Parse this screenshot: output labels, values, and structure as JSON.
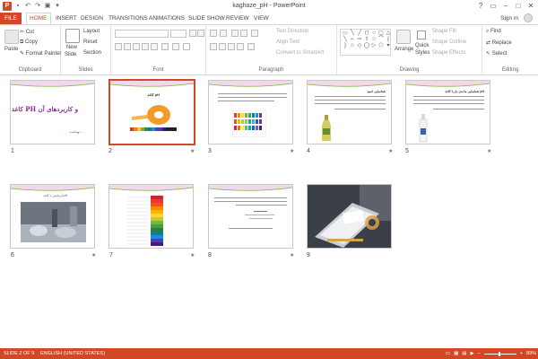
{
  "titlebar": {
    "title": "kaghaze_pH - PowerPoint",
    "app_icon": "P",
    "qat": [
      "save-icon",
      "undo-icon",
      "redo-icon",
      "presentation-icon",
      "customize-icon"
    ],
    "window_buttons": [
      "?",
      "▭",
      "–",
      "□",
      "✕"
    ]
  },
  "tabs": {
    "file": "FILE",
    "items": [
      "HOME",
      "INSERT",
      "DESIGN",
      "TRANSITIONS",
      "ANIMATIONS",
      "SLIDE SHOW",
      "REVIEW",
      "VIEW"
    ],
    "active": "HOME",
    "sign_in": "Sign in"
  },
  "ribbon": {
    "clipboard": {
      "label": "Clipboard",
      "paste": "Paste",
      "cut": "Cut",
      "copy": "Copy",
      "format_painter": "Format Painter"
    },
    "slides": {
      "label": "Slides",
      "new_slide": "New",
      "new_slide_2": "Slide",
      "layout": "Layout",
      "reset": "Reset",
      "section": "Section"
    },
    "font": {
      "label": "Font"
    },
    "paragraph": {
      "label": "Paragraph",
      "text_direction": "Text Direction",
      "align_text": "Align Text",
      "convert": "Convert to SmartArt"
    },
    "drawing": {
      "label": "Drawing",
      "arrange": "Arrange",
      "quick_styles": "Quick",
      "quick_styles_2": "Styles",
      "shape_fill": "Shape Fill",
      "shape_outline": "Shape Outline",
      "shape_effects": "Shape Effects"
    },
    "editing": {
      "label": "Editing",
      "find": "Find",
      "replace": "Replace",
      "select": "Select"
    }
  },
  "slides": [
    {
      "num": "1",
      "title": "کاغذ PH و کاربرد‌های آن",
      "subtitle": "تهیه‌کننده: ..."
    },
    {
      "num": "2",
      "title": "کاغذ pH"
    },
    {
      "num": "3",
      "title": ""
    },
    {
      "num": "4",
      "title": "شناسایی اسید"
    },
    {
      "num": "5",
      "title": "شناسایی ماده‌ی باز با کاغذ pH"
    },
    {
      "num": "6",
      "title": "آزمایش با کاغذ pH"
    },
    {
      "num": "7",
      "title": ""
    },
    {
      "num": "8",
      "title": ""
    },
    {
      "num": "9",
      "title": ""
    }
  ],
  "statusbar": {
    "slide_info": "SLIDE 2 OF 9",
    "language": "ENGLISH (UNITED STATES)",
    "zoom": "89%"
  },
  "colors": {
    "accent": "#d24726"
  }
}
